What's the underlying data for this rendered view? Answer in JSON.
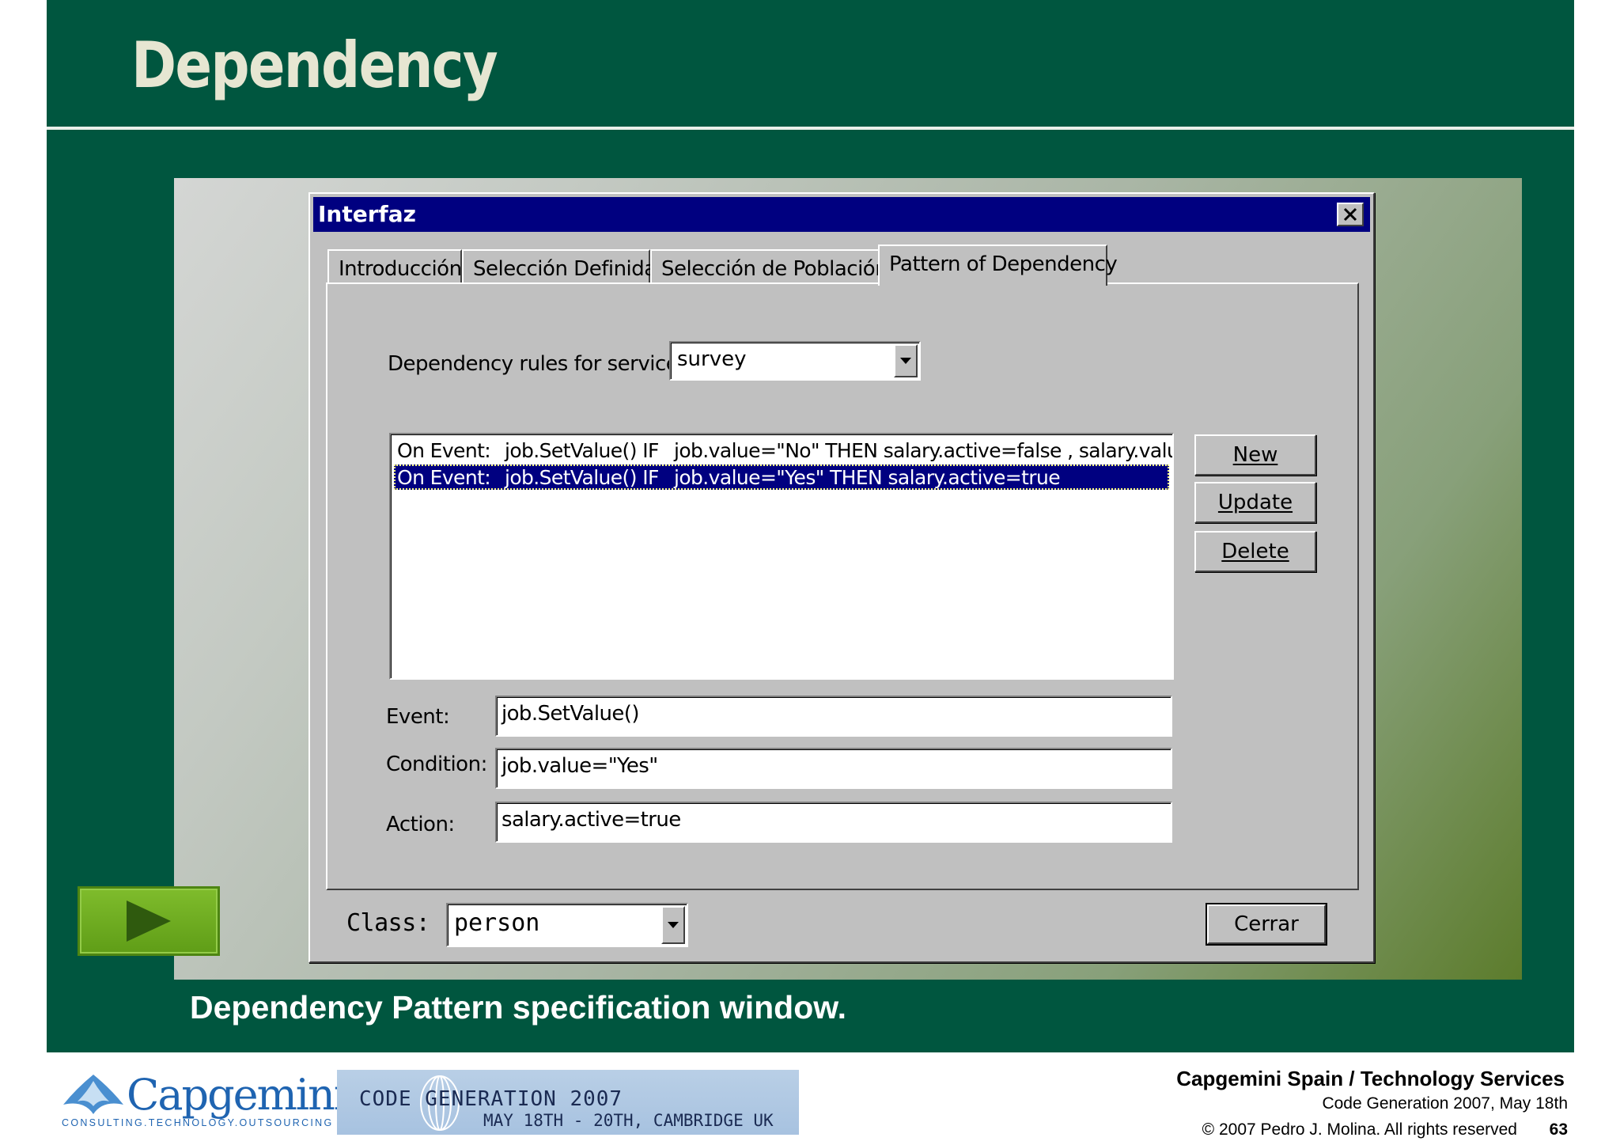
{
  "slide": {
    "title": "Dependency",
    "caption": "Dependency Pattern specification window.",
    "play_button_icon": "play-icon",
    "colors": {
      "background": "#00563f",
      "title": "#e6e6d2",
      "rule": "#e9efe9"
    }
  },
  "dialog": {
    "title": "Interfaz",
    "close_icon": "close-icon",
    "tabs": [
      {
        "label": "Introducción"
      },
      {
        "label": "Selección Definida"
      },
      {
        "label": "Selección de Población"
      },
      {
        "label": "Pattern of Dependency",
        "active": true
      }
    ],
    "service_label": "Dependency rules for service:",
    "service_value": "survey",
    "rules": [
      {
        "event_label": "On Event:",
        "event": "job.SetValue() IF",
        "text": "job.value=\"No\" THEN salary.active=false , salary.value=",
        "selected": false
      },
      {
        "event_label": "On Event:",
        "event": "job.SetValue() IF",
        "text": "job.value=\"Yes\" THEN salary.active=true",
        "selected": true
      }
    ],
    "buttons": {
      "new": "New",
      "update": "Update",
      "delete": "Delete",
      "close": "Cerrar"
    },
    "fields": {
      "event_label": "Event:",
      "event_value": "job.SetValue()",
      "condition_label": "Condition:",
      "condition_value": "job.value=\"Yes\"",
      "action_label": "Action:",
      "action_value": "salary.active=true"
    },
    "class_label": "Class:",
    "class_value": "person",
    "colors": {
      "face": "#c0c0c0",
      "titlebar": "#000080",
      "selection": "#000080"
    }
  },
  "footer": {
    "logo_text": "Capgemini",
    "logo_tagline": "CONSULTING.TECHNOLOGY.OUTSOURCING",
    "banner_title": "CODE   GENERATION 2007",
    "banner_subtitle": "MAY 18TH - 20TH, CAMBRIDGE UK",
    "company": "Capgemini Spain / Technology Services",
    "event": "Code Generation 2007, May 18th",
    "copyright": "© 2007 Pedro J. Molina. All rights reserved",
    "page_number": "63",
    "colors": {
      "logo": "#1f64b1",
      "banner": "#a7c2e0"
    }
  }
}
